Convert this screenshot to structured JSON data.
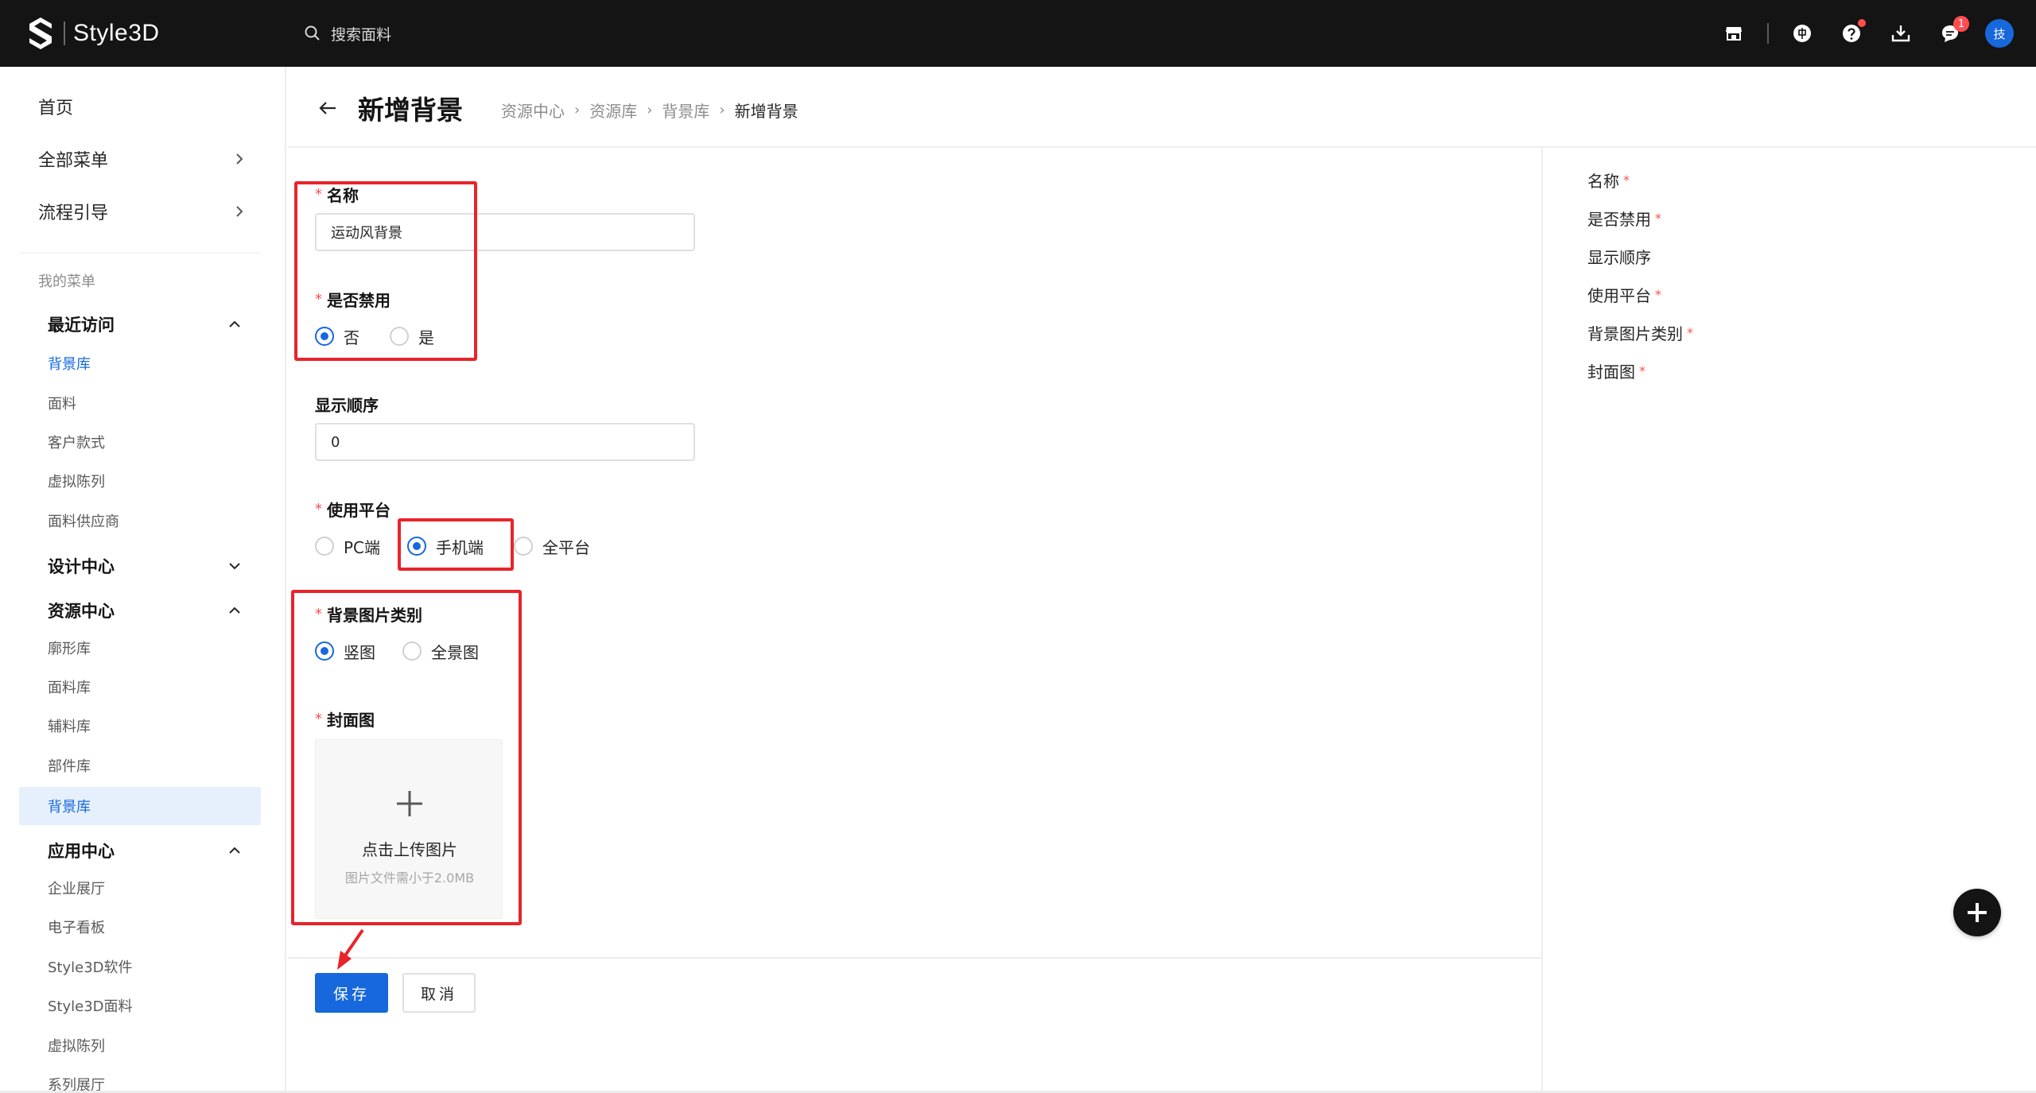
{
  "topbar": {
    "logo_text": "Style3D",
    "search_placeholder": "搜索面料",
    "message_count": "1",
    "avatar_text": "技"
  },
  "sidebar": {
    "home": "首页",
    "all_menu": "全部菜单",
    "process_guide": "流程引导",
    "my_menu_caption": "我的菜单",
    "groups": {
      "recent": {
        "title": "最近访问",
        "items": [
          "背景库",
          "面料",
          "客户款式",
          "虚拟陈列",
          "面料供应商"
        ]
      },
      "design": {
        "title": "设计中心"
      },
      "resource": {
        "title": "资源中心",
        "items": [
          "廓形库",
          "面料库",
          "辅料库",
          "部件库",
          "背景库"
        ]
      },
      "app": {
        "title": "应用中心",
        "items": [
          "企业展厅",
          "电子看板",
          "Style3D软件",
          "Style3D面料",
          "虚拟陈列",
          "系列展厅"
        ]
      }
    }
  },
  "header": {
    "title": "新增背景",
    "breadcrumb": [
      "资源中心",
      "资源库",
      "背景库",
      "新增背景"
    ]
  },
  "form": {
    "name": {
      "label": "名称",
      "value": "运动风背景"
    },
    "disabled": {
      "label": "是否禁用",
      "options": [
        "否",
        "是"
      ],
      "selected": "否"
    },
    "order": {
      "label": "显示顺序",
      "value": "0"
    },
    "platform": {
      "label": "使用平台",
      "options": [
        "PC端",
        "手机端",
        "全平台"
      ],
      "selected": "手机端"
    },
    "bg_type": {
      "label": "背景图片类别",
      "options": [
        "竖图",
        "全景图"
      ],
      "selected": "竖图"
    },
    "cover": {
      "label": "封面图",
      "upload_text": "点击上传图片",
      "upload_hint": "图片文件需小于2.0MB"
    },
    "save_label": "保存",
    "cancel_label": "取消"
  },
  "anchors": [
    "名称",
    "是否禁用",
    "显示顺序",
    "使用平台",
    "背景图片类别",
    "封面图"
  ],
  "colors": {
    "primary": "#1668dc",
    "topbar": "#141414",
    "required": "#ff4d4f",
    "annotation": "#e8242b"
  }
}
